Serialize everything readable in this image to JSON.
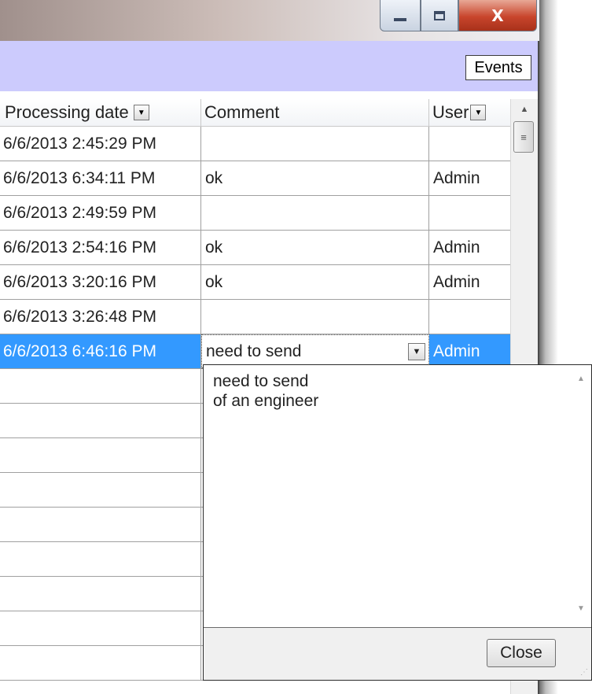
{
  "window_buttons": {
    "close_label": "X"
  },
  "toolbar": {
    "events_label": "Events"
  },
  "columns": [
    {
      "label": "Processing date",
      "has_dropdown": true
    },
    {
      "label": "Comment",
      "has_dropdown": false
    },
    {
      "label": "User",
      "has_dropdown": true
    }
  ],
  "rows": [
    {
      "date": "6/6/2013 2:45:29 PM",
      "comment": "",
      "user": ""
    },
    {
      "date": "6/6/2013 6:34:11 PM",
      "comment": "ok",
      "user": "Admin"
    },
    {
      "date": "6/6/2013 2:49:59 PM",
      "comment": "",
      "user": ""
    },
    {
      "date": "6/6/2013 2:54:16 PM",
      "comment": "ok",
      "user": "Admin"
    },
    {
      "date": "6/6/2013 3:20:16 PM",
      "comment": "ok",
      "user": "Admin"
    },
    {
      "date": "6/6/2013 3:26:48 PM",
      "comment": "",
      "user": ""
    },
    {
      "date": "6/6/2013 6:46:16 PM",
      "comment": "need to send",
      "user": "Admin",
      "selected": true
    }
  ],
  "empty_row_count": 9,
  "popup": {
    "text_line1": "need to send",
    "text_line2": "of an engineer",
    "close_label": "Close"
  },
  "colors": {
    "toolbar_bg": "#cccbfd",
    "selection": "#3399ff"
  }
}
